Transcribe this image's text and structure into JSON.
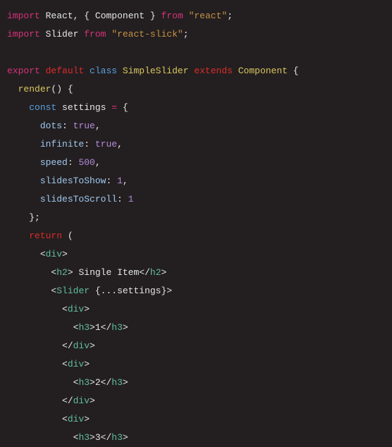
{
  "t": [
    "import",
    "React",
    ",",
    "{",
    "Component",
    "}",
    "from",
    "\"react\"",
    ";",
    "import",
    "Slider",
    "from",
    "\"react-slick\"",
    ";",
    "export",
    "default",
    "class",
    "SimpleSlider",
    "extends",
    "Component",
    "{",
    "render",
    "()",
    "{",
    "const",
    "settings",
    "=",
    "{",
    "dots",
    ":",
    "true",
    ",",
    "infinite",
    ":",
    "true",
    ",",
    "speed",
    ":",
    "500",
    ",",
    "slidesToShow",
    ":",
    "1",
    ",",
    "slidesToScroll",
    ":",
    "1",
    "};",
    "return",
    "(",
    "<",
    "div",
    ">",
    "<",
    "h2",
    ">",
    "Single Item",
    "</",
    "h2",
    ">",
    "<",
    "Slider",
    "{...",
    "settings",
    "}>",
    "<",
    "div",
    ">",
    "<",
    "h3",
    ">",
    "1",
    "</",
    "h3",
    ">",
    "</",
    "div",
    ">",
    "<",
    "div",
    ">",
    "<",
    "h3",
    ">",
    "2",
    "</",
    "h3",
    ">",
    "</",
    "div",
    ">",
    "<",
    "div",
    ">",
    "<",
    "h3",
    ">",
    "3",
    "</",
    "h3",
    ">"
  ]
}
